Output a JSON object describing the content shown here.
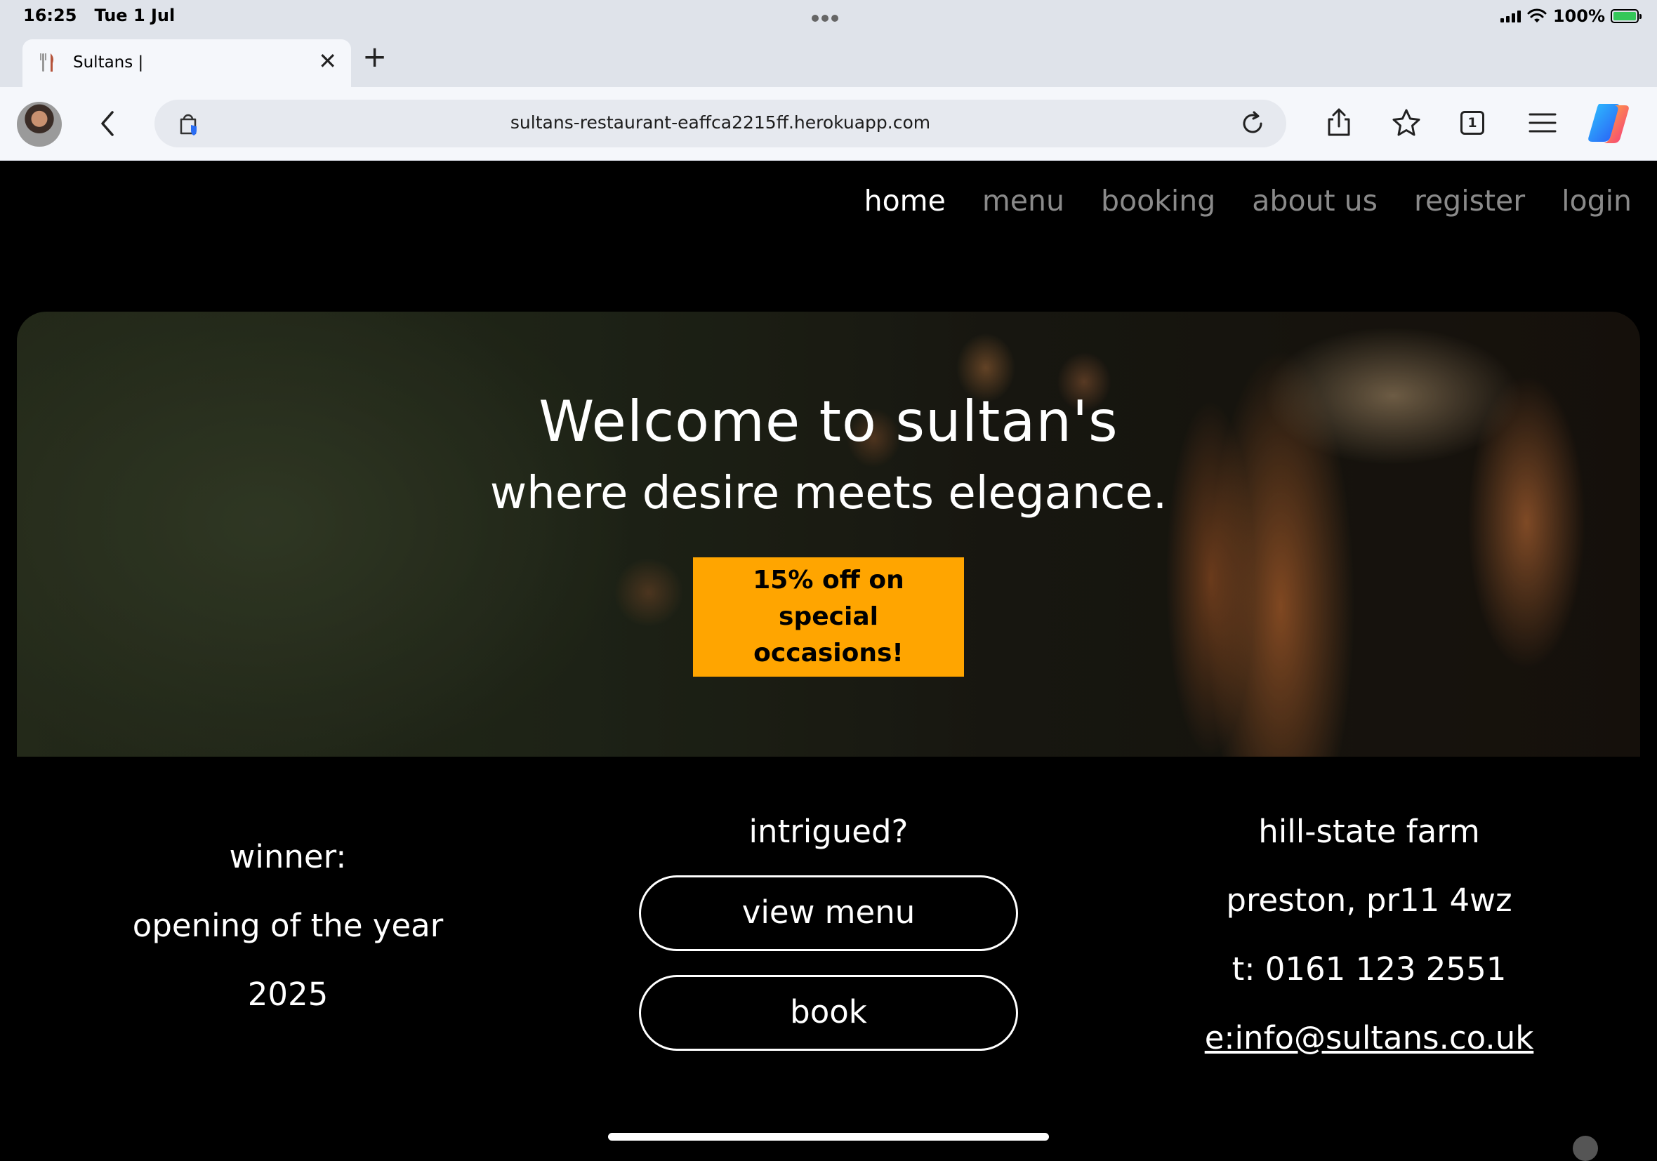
{
  "status_bar": {
    "time": "16:25",
    "date": "Tue 1 Jul",
    "battery": "100%",
    "battery_color": "#34c759"
  },
  "browser": {
    "tab": {
      "title": "Sultans |",
      "favicon": "fork-knife-icon"
    },
    "address": "sultans-restaurant-eaffca2215ff.herokuapp.com",
    "tab_count": "1",
    "toolbar_icons": [
      "share-icon",
      "star-icon",
      "tabs-icon",
      "menu-icon",
      "copilot-icon"
    ]
  },
  "nav": {
    "items": [
      "home",
      "menu",
      "booking",
      "about us",
      "register",
      "login"
    ],
    "active": "home"
  },
  "hero": {
    "title": "Welcome to sultan's",
    "subtitle": "where desire meets elegance.",
    "offer": "15% off on special occasions!",
    "offer_color": "#ffa500"
  },
  "award": {
    "line1": "winner:",
    "line2": "opening of the year",
    "line3": "2025"
  },
  "cta": {
    "heading": "intrigued?",
    "view_menu": "view menu",
    "book": "book"
  },
  "contact": {
    "address1": "hill-state farm",
    "address2": "preston, pr11 4wz",
    "phone": "t: 0161 123 2551",
    "email": "e:info@sultans.co.uk"
  }
}
